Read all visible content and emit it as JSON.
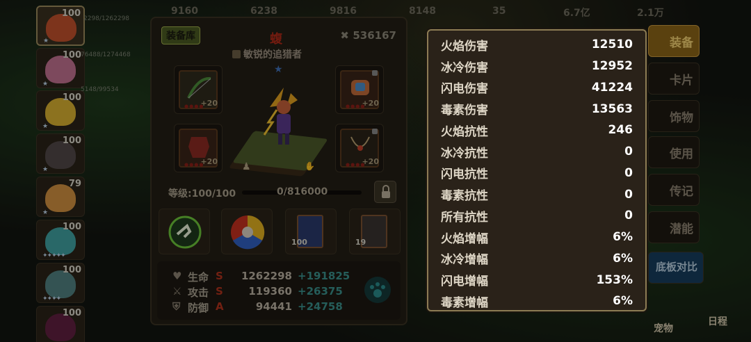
{
  "top_resources": [
    "9160",
    "6238",
    "9816",
    "8148",
    "35",
    "6.7亿",
    "2.1万"
  ],
  "heroes": [
    {
      "level": "100",
      "stars": "★",
      "hp": "2298/1262298",
      "color": "#c0502c"
    },
    {
      "level": "100",
      "stars": "★",
      "hp": "76488/1274468",
      "color": "#c07090"
    },
    {
      "level": "100",
      "stars": "★",
      "hp": "5148/99534",
      "color": "#d8b030"
    },
    {
      "level": "100",
      "stars": "★",
      "hp": "",
      "color": "#504848"
    },
    {
      "level": "79",
      "stars": "★",
      "hp": "",
      "color": "#d09040"
    },
    {
      "level": "100",
      "stars": "✦✦✦✦✦",
      "hp": "",
      "color": "#40a0a0"
    },
    {
      "level": "100",
      "stars": "✦✦✦✦",
      "hp": "",
      "color": "#508080"
    },
    {
      "level": "100",
      "stars": "",
      "hp": "",
      "color": "#602040"
    }
  ],
  "panel": {
    "equip_library": "装备库",
    "hero_name": "蝮",
    "power_value": "536167",
    "hero_title": "敏锐的追猎者",
    "level_label": "等级:100/100",
    "xp_text": "0/816000",
    "gear_plus": [
      "+20",
      "+20",
      "+20",
      "+20"
    ],
    "skill_levels": [
      "100",
      "19"
    ],
    "stats": [
      {
        "name": "生命",
        "grade": "S",
        "value": "1262298",
        "bonus": "+191825"
      },
      {
        "name": "攻击",
        "grade": "S",
        "value": "119360",
        "bonus": "+26375"
      },
      {
        "name": "防御",
        "grade": "A",
        "value": "94441",
        "bonus": "+24758"
      }
    ]
  },
  "side_tabs": [
    "装备",
    "卡片",
    "饰物",
    "使用",
    "传记",
    "潜能",
    "底板对比"
  ],
  "popup_stats": [
    {
      "key": "火焰伤害",
      "value": "12510"
    },
    {
      "key": "冰冷伤害",
      "value": "12952"
    },
    {
      "key": "闪电伤害",
      "value": "41224"
    },
    {
      "key": "毒素伤害",
      "value": "13563"
    },
    {
      "key": "火焰抗性",
      "value": "246"
    },
    {
      "key": "冰冷抗性",
      "value": "0"
    },
    {
      "key": "闪电抗性",
      "value": "0"
    },
    {
      "key": "毒素抗性",
      "value": "0"
    },
    {
      "key": "所有抗性",
      "value": "0"
    },
    {
      "key": "火焰增幅",
      "value": "6%"
    },
    {
      "key": "冰冷增幅",
      "value": "6%"
    },
    {
      "key": "闪电增幅",
      "value": "153%"
    },
    {
      "key": "毒素增幅",
      "value": "6%"
    }
  ],
  "bottom": {
    "pet": "宠物",
    "schedule": "日程"
  },
  "colors": {
    "accent_gold": "#8a6418",
    "stat_bonus": "#3a8f8a",
    "grade_red": "#b02a18",
    "popup_border": "#8c7c54"
  }
}
